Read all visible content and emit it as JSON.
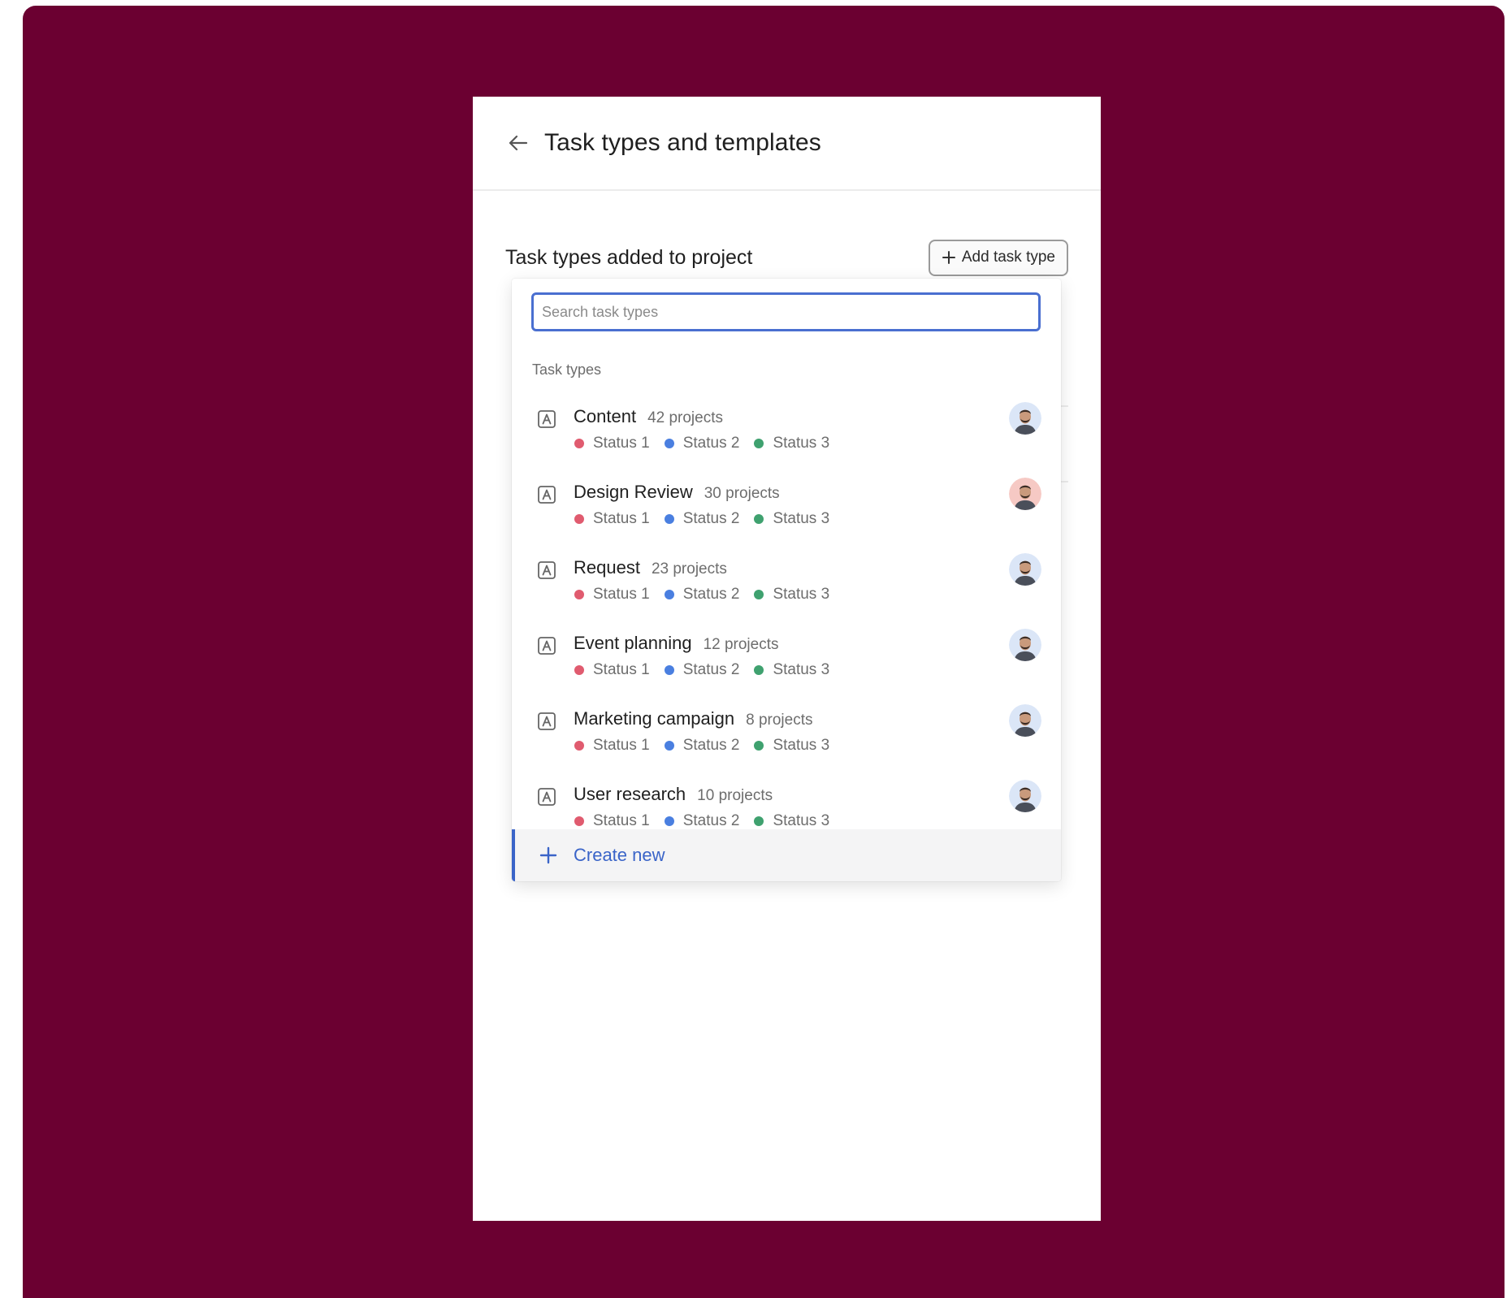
{
  "header": {
    "title": "Task types and templates"
  },
  "section": {
    "title": "Task types added to project",
    "add_label": "Add task type"
  },
  "dropdown": {
    "search_placeholder": "Search task types",
    "group_label": "Task types",
    "create_label": "Create new",
    "items": [
      {
        "name": "Content",
        "count": "42 projects",
        "statuses": [
          "Status 1",
          "Status 2",
          "Status 3"
        ],
        "avatar_bg": "#dbe6f7"
      },
      {
        "name": "Design Review",
        "count": "30 projects",
        "statuses": [
          "Status 1",
          "Status 2",
          "Status 3"
        ],
        "avatar_bg": "#f6c9c4"
      },
      {
        "name": "Request",
        "count": "23 projects",
        "statuses": [
          "Status 1",
          "Status 2",
          "Status 3"
        ],
        "avatar_bg": "#dbe6f7"
      },
      {
        "name": "Event planning",
        "count": "12 projects",
        "statuses": [
          "Status 1",
          "Status 2",
          "Status 3"
        ],
        "avatar_bg": "#dbe6f7"
      },
      {
        "name": "Marketing campaign",
        "count": "8 projects",
        "statuses": [
          "Status 1",
          "Status 2",
          "Status 3"
        ],
        "avatar_bg": "#dbe6f7"
      },
      {
        "name": "User research",
        "count": "10 projects",
        "statuses": [
          "Status 1",
          "Status 2",
          "Status 3"
        ],
        "avatar_bg": "#dbe6f7"
      }
    ]
  },
  "colors": {
    "backdrop": "#6b0031",
    "accent": "#3a64c8",
    "status_1": "#e05b6f",
    "status_2": "#4a7fe0",
    "status_3": "#3fa16f"
  },
  "icons": {
    "back": "arrow-left-icon",
    "add": "plus-icon",
    "type": "letter-a-box-icon",
    "create": "plus-icon"
  }
}
